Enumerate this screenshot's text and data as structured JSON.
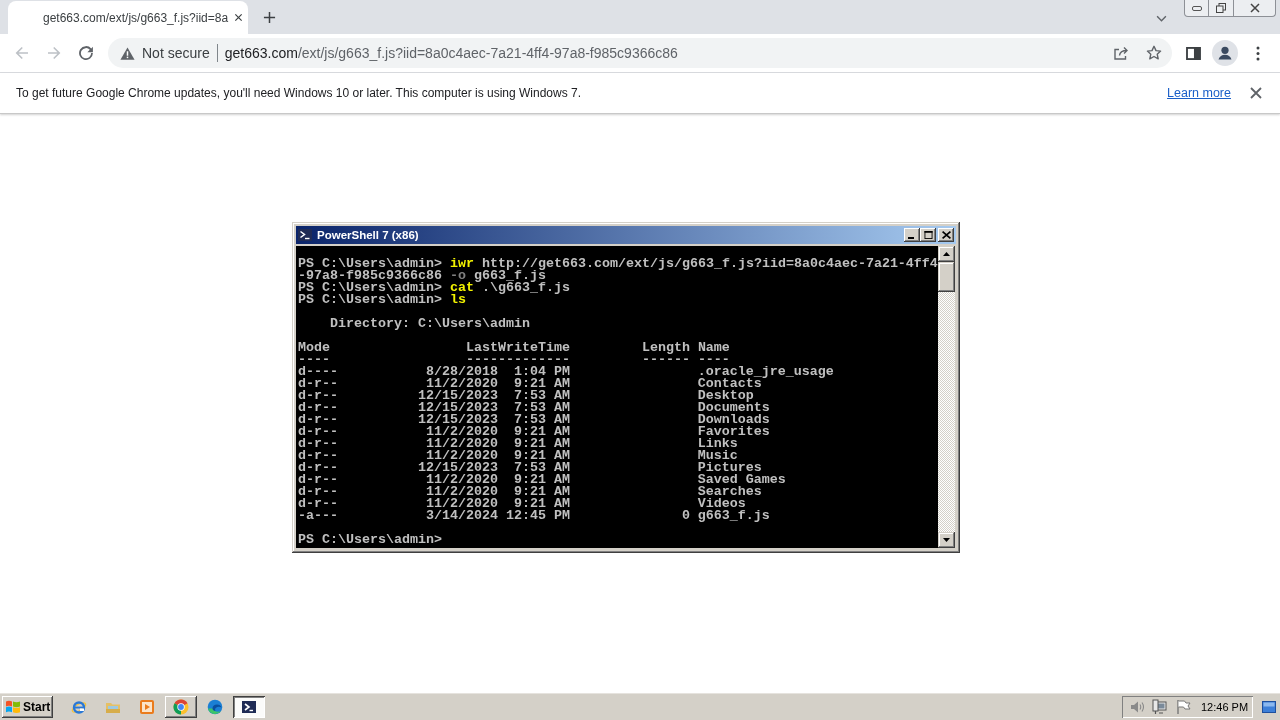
{
  "browser": {
    "tabs": [
      {
        "title": "get663.com/ext/js/g663_f.js?iid=8a",
        "selected": true
      }
    ],
    "address_bar": {
      "security_label": "Not secure",
      "host": "get663.com",
      "path": "/ext/js/g663_f.js?iid=8a0c4aec-7a21-4ff4-97a8-f985c9366c86"
    },
    "infobar": {
      "message": "To get future Google Chrome updates, you'll need Windows 10 or later. This computer is using Windows 7.",
      "link": "Learn more"
    }
  },
  "console_window": {
    "title": "PowerShell 7 (x86)",
    "lines": [
      {
        "kind": "command",
        "prompt": "PS C:\\Users\\admin>",
        "parts": [
          {
            "kind": "cmdlet",
            "text": "iwr"
          },
          {
            "kind": "argument",
            "text": "http://get663.com/ext/js/g663_f.js?iid=8a0c4aec-7a21-4ff4"
          }
        ]
      },
      {
        "kind": "continuation",
        "parts": [
          {
            "kind": "argument",
            "text": "-97a8-f985c9366c86"
          },
          {
            "kind": "parameter",
            "text": "-o"
          },
          {
            "kind": "argument",
            "text": "g663_f.js"
          }
        ]
      },
      {
        "kind": "command",
        "prompt": "PS C:\\Users\\admin>",
        "parts": [
          {
            "kind": "cmdlet",
            "text": "cat"
          },
          {
            "kind": "argument",
            "text": ".\\g663_f.js"
          }
        ]
      },
      {
        "kind": "command",
        "prompt": "PS C:\\Users\\admin>",
        "parts": [
          {
            "kind": "cmdlet",
            "text": "ls"
          }
        ]
      },
      {
        "kind": "heading",
        "text": "Directory: C:\\Users\\admin"
      },
      {
        "kind": "listing",
        "columns": [
          {
            "label": "Mode",
            "rule": "----"
          },
          {
            "label": "LastWriteTime",
            "rule": "-------------"
          },
          {
            "label": "Length",
            "rule": "------"
          },
          {
            "label": "Name",
            "rule": "----"
          }
        ],
        "rows": [
          {
            "mode": "d----",
            "date": "8/28/2018",
            "time": "1:04 PM",
            "name": ".oracle_jre_usage"
          },
          {
            "mode": "d-r--",
            "date": "11/2/2020",
            "time": "9:21 AM",
            "name": "Contacts"
          },
          {
            "mode": "d-r--",
            "date": "12/15/2023",
            "time": "7:53 AM",
            "name": "Desktop"
          },
          {
            "mode": "d-r--",
            "date": "12/15/2023",
            "time": "7:53 AM",
            "name": "Documents"
          },
          {
            "mode": "d-r--",
            "date": "12/15/2023",
            "time": "7:53 AM",
            "name": "Downloads"
          },
          {
            "mode": "d-r--",
            "date": "11/2/2020",
            "time": "9:21 AM",
            "name": "Favorites"
          },
          {
            "mode": "d-r--",
            "date": "11/2/2020",
            "time": "9:21 AM",
            "name": "Links"
          },
          {
            "mode": "d-r--",
            "date": "11/2/2020",
            "time": "9:21 AM",
            "name": "Music"
          },
          {
            "mode": "d-r--",
            "date": "12/15/2023",
            "time": "7:53 AM",
            "name": "Pictures"
          },
          {
            "mode": "d-r--",
            "date": "11/2/2020",
            "time": "9:21 AM",
            "name": "Saved Games"
          },
          {
            "mode": "d-r--",
            "date": "11/2/2020",
            "time": "9:21 AM",
            "name": "Searches"
          },
          {
            "mode": "d-r--",
            "date": "11/2/2020",
            "time": "9:21 AM",
            "name": "Videos"
          },
          {
            "mode": "-a---",
            "date": "3/14/2024",
            "time": "12:45 PM",
            "length": "0",
            "name": "g663_f.js"
          }
        ]
      },
      {
        "kind": "command",
        "prompt": "PS C:\\Users\\admin>"
      }
    ]
  },
  "taskbar": {
    "start_label": "Start",
    "apps": [
      {
        "running": false,
        "selected": false
      },
      {
        "running": false,
        "selected": false
      },
      {
        "running": false,
        "selected": false
      },
      {
        "running": true,
        "selected": false
      },
      {
        "running": false,
        "selected": false
      },
      {
        "running": true,
        "selected": true
      }
    ],
    "clock": "12:46 PM"
  }
}
